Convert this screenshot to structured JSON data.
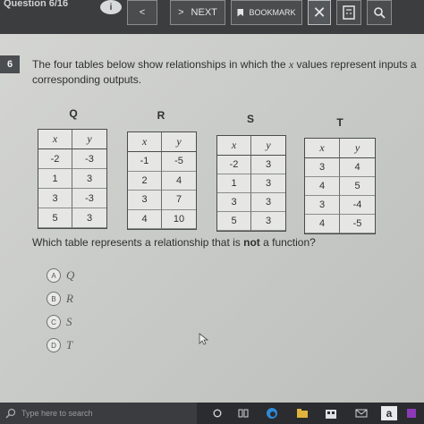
{
  "toolbar": {
    "question_counter": "Question 6/16",
    "prev_symbol": "<",
    "next_label": "NEXT",
    "next_symbol": ">",
    "bookmark_label": "BOOKMARK",
    "close_symbol": "✕"
  },
  "question": {
    "number": "6",
    "prompt_line1_pre": "The four tables below show relationships in which the ",
    "prompt_line1_var": "x",
    "prompt_line1_post": " values represent inputs a",
    "prompt_line2": "corresponding outputs.",
    "question_pre": "Which table represents a relationship that is ",
    "question_bold": "not",
    "question_post": " a function?"
  },
  "tables": [
    {
      "title": "Q",
      "header": [
        "x",
        "y"
      ],
      "rows": [
        [
          "-2",
          "-3"
        ],
        [
          "1",
          "3"
        ],
        [
          "3",
          "-3"
        ],
        [
          "5",
          "3"
        ]
      ]
    },
    {
      "title": "R",
      "header": [
        "x",
        "y"
      ],
      "rows": [
        [
          "-1",
          "-5"
        ],
        [
          "2",
          "4"
        ],
        [
          "3",
          "7"
        ],
        [
          "4",
          "10"
        ]
      ]
    },
    {
      "title": "S",
      "header": [
        "x",
        "y"
      ],
      "rows": [
        [
          "-2",
          "3"
        ],
        [
          "1",
          "3"
        ],
        [
          "3",
          "3"
        ],
        [
          "5",
          "3"
        ]
      ]
    },
    {
      "title": "T",
      "header": [
        "x",
        "y"
      ],
      "rows": [
        [
          "3",
          "4"
        ],
        [
          "4",
          "5"
        ],
        [
          "3",
          "-4"
        ],
        [
          "4",
          "-5"
        ]
      ]
    }
  ],
  "options": [
    {
      "letter": "A",
      "label": "Q"
    },
    {
      "letter": "B",
      "label": "R"
    },
    {
      "letter": "C",
      "label": "S"
    },
    {
      "letter": "D",
      "label": "T"
    }
  ],
  "taskbar": {
    "search_placeholder": "Type here to search"
  },
  "colors": {
    "toolbar": "#3b3d3f",
    "page": "#cfd0cd",
    "taskbar": "#2a2c2f"
  }
}
